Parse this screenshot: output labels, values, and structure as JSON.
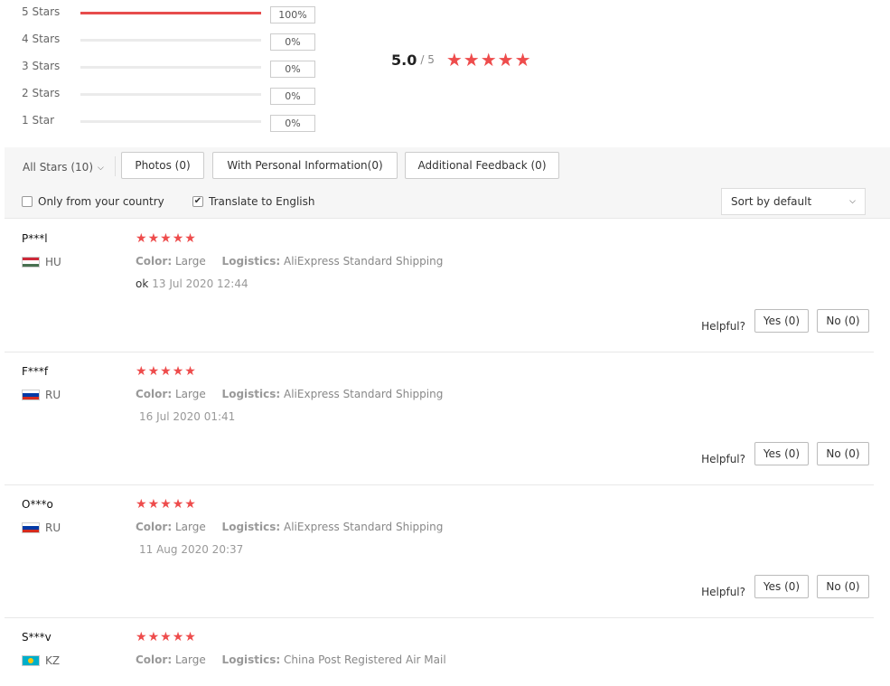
{
  "histogram": [
    {
      "label": "5 Stars",
      "percent": "100%",
      "fraction": 1.0
    },
    {
      "label": "4 Stars",
      "percent": "0%",
      "fraction": 0
    },
    {
      "label": "3 Stars",
      "percent": "0%",
      "fraction": 0
    },
    {
      "label": "2 Stars",
      "percent": "0%",
      "fraction": 0
    },
    {
      "label": "1 Star",
      "percent": "0%",
      "fraction": 0
    }
  ],
  "average": {
    "value": "5.0",
    "out_of": "/ 5",
    "stars": 5
  },
  "filters": {
    "all_stars": "All Stars (10)",
    "photos": "Photos (0)",
    "personal_info": "With Personal Information(0)",
    "additional_feedback": "Additional Feedback (0)",
    "only_country": "Only from your country",
    "translate": "Translate to English",
    "translate_checked": true,
    "sort": "Sort by default"
  },
  "reviews": [
    {
      "name": "P***l",
      "country": "HU",
      "stars": 5,
      "color_label": "Color:",
      "color": "Large",
      "logistics_label": "Logistics:",
      "logistics": "AliExpress Standard Shipping",
      "text": "ok",
      "date": "13 Jul 2020 12:44",
      "helpful": "Helpful?",
      "yes": "Yes (0)",
      "no": "No (0)"
    },
    {
      "name": "F***f",
      "country": "RU",
      "stars": 5,
      "color_label": "Color:",
      "color": "Large",
      "logistics_label": "Logistics:",
      "logistics": "AliExpress Standard Shipping",
      "text": "",
      "date": "16 Jul 2020 01:41",
      "helpful": "Helpful?",
      "yes": "Yes (0)",
      "no": "No (0)"
    },
    {
      "name": "O***o",
      "country": "RU",
      "stars": 5,
      "color_label": "Color:",
      "color": "Large",
      "logistics_label": "Logistics:",
      "logistics": "AliExpress Standard Shipping",
      "text": "",
      "date": "11 Aug 2020 20:37",
      "helpful": "Helpful?",
      "yes": "Yes (0)",
      "no": "No (0)"
    },
    {
      "name": "S***v",
      "country": "KZ",
      "stars": 5,
      "color_label": "Color:",
      "color": "Large",
      "logistics_label": "Logistics:",
      "logistics": "China Post Registered Air Mail",
      "text": "",
      "date": "",
      "helpful": "",
      "yes": "",
      "no": ""
    }
  ],
  "colors": {
    "star": "#ee4c4c",
    "bar_fill": "#e74c4c",
    "bar_track": "#ebebeb"
  }
}
